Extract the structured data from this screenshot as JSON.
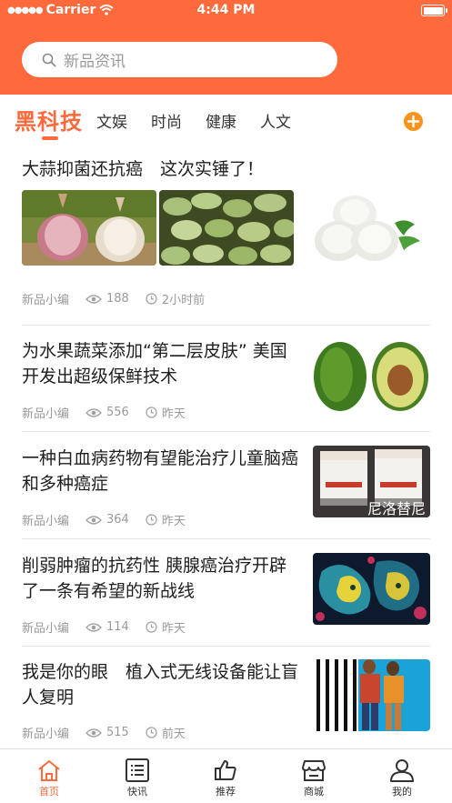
{
  "status_bar": {
    "carrier": "Carrier",
    "time": "4:44 PM"
  },
  "search": {
    "placeholder": "新品资讯"
  },
  "tabs": [
    {
      "label": "黑科技"
    },
    {
      "label": "文娱"
    },
    {
      "label": "时尚"
    },
    {
      "label": "健康"
    },
    {
      "label": "人文"
    }
  ],
  "articles": [
    {
      "title": "大蒜抑菌还抗癌　这次实锤了！",
      "author": "新品小编",
      "views": "188",
      "time": "2小时前"
    },
    {
      "title": "为水果蔬菜添加“第二层皮肤”  美国开发出超级保鲜技术",
      "author": "新品小编",
      "views": "556",
      "time": "昨天"
    },
    {
      "title": "一种白血病药物有望能治疗儿童脑癌和多种癌症",
      "author": "新品小编",
      "views": "364",
      "time": "昨天",
      "thumb_caption": "尼洛替尼"
    },
    {
      "title": "削弱肿瘤的抗药性  胰腺癌治疗开辟了一条有希望的新战线",
      "author": "新品小编",
      "views": "114",
      "time": "昨天"
    },
    {
      "title": "我是你的眼　植入式无线设备能让盲人复明",
      "author": "新品小编",
      "views": "515",
      "time": "前天"
    }
  ],
  "bottom_nav": [
    {
      "label": "首页",
      "active": true
    },
    {
      "label": "快讯"
    },
    {
      "label": "推荐"
    },
    {
      "label": "商城"
    },
    {
      "label": "我的"
    }
  ],
  "colors": {
    "accent": "#ff6a3d",
    "add_button": "#f7941d"
  }
}
